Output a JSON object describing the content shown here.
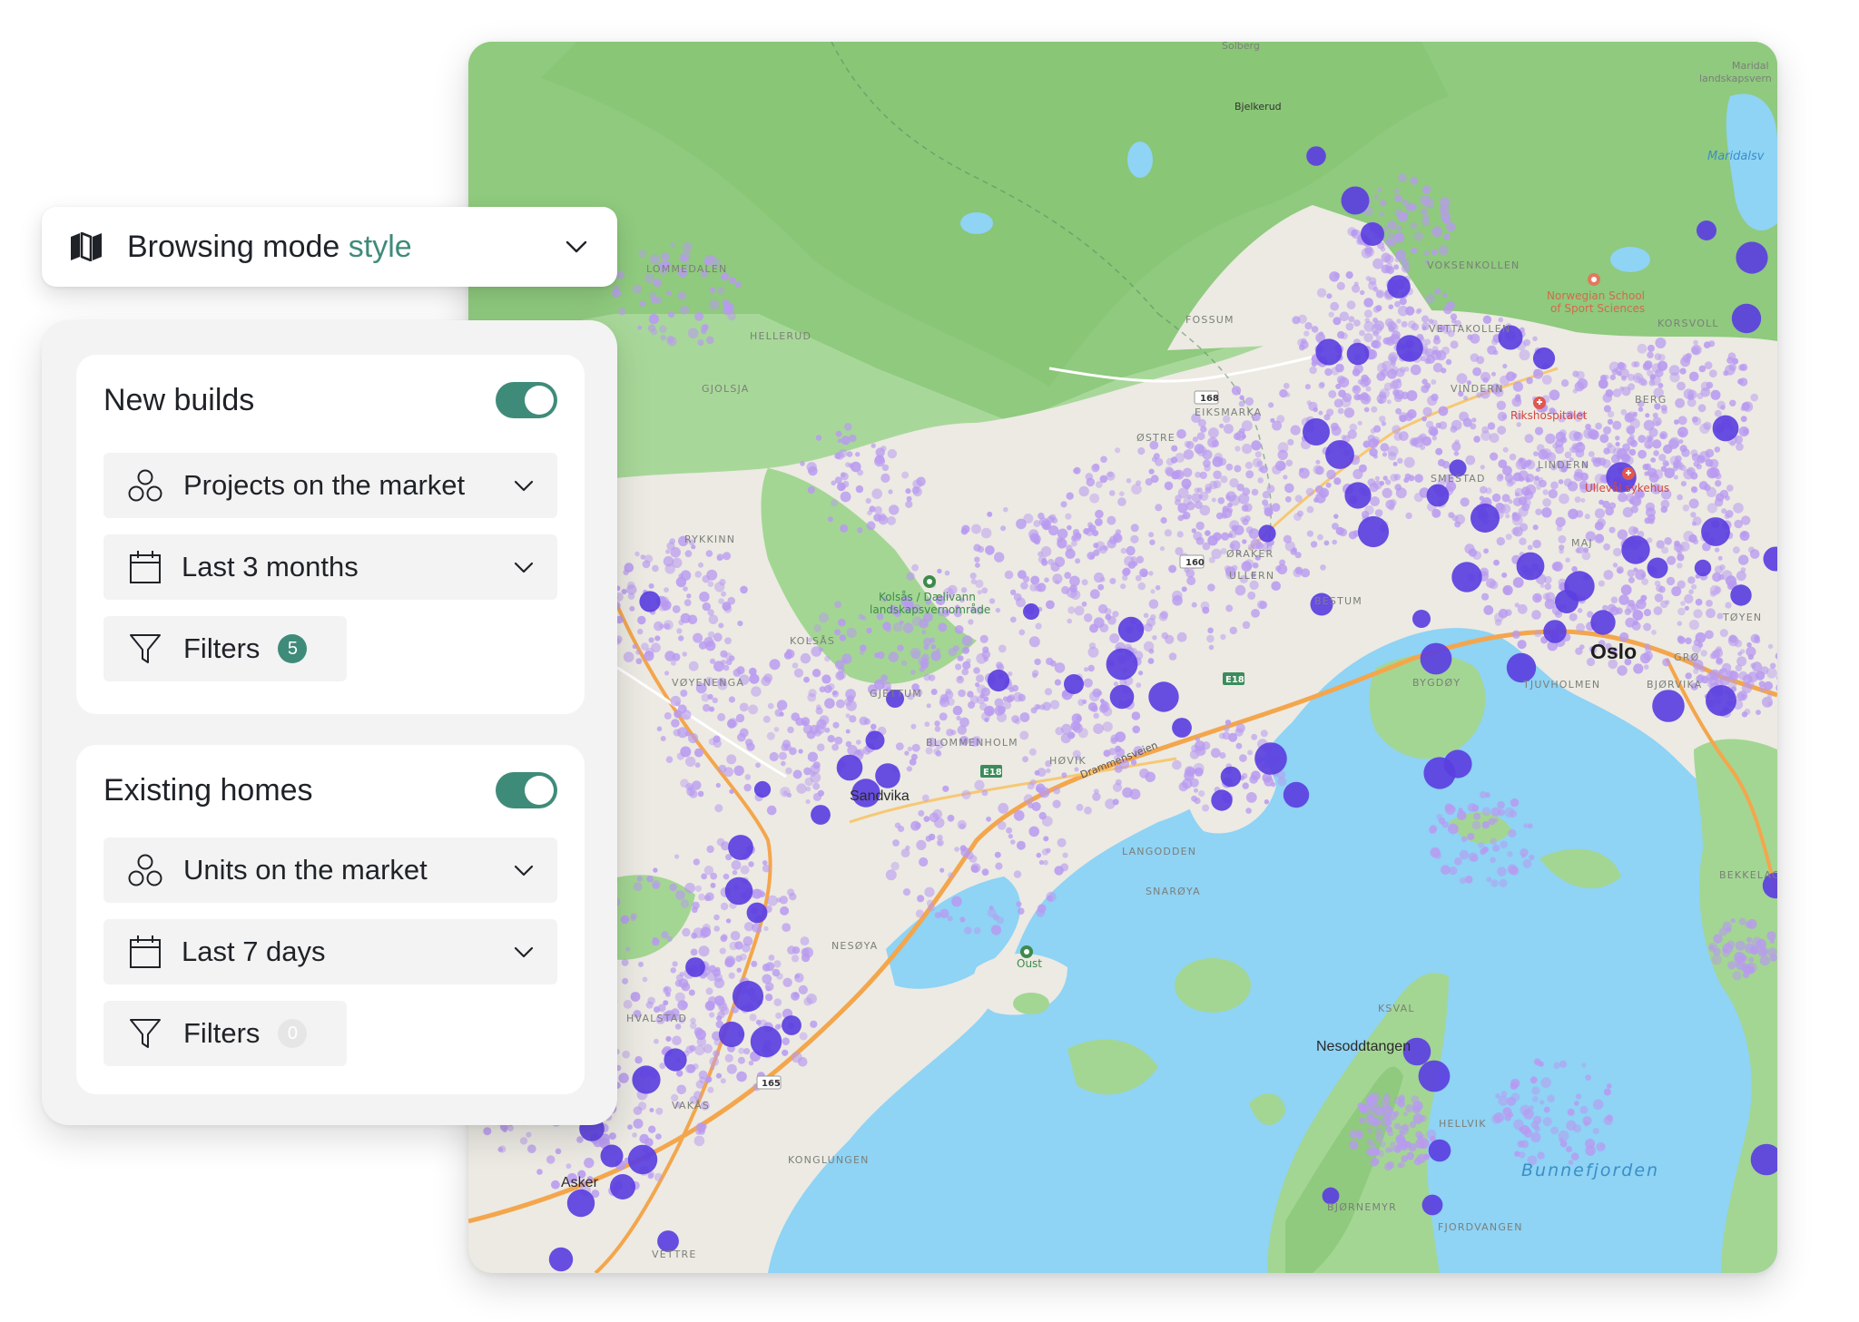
{
  "mode_select": {
    "label_main": "Browsing mode",
    "label_accent": "style",
    "icon": "map-icon"
  },
  "sections": [
    {
      "title": "New builds",
      "enabled": true,
      "type_label": "Projects on the market",
      "period_label": "Last 3 months",
      "filters_label": "Filters",
      "filters_count": "5"
    },
    {
      "title": "Existing homes",
      "enabled": true,
      "type_label": "Units on the market",
      "period_label": "Last 7 days",
      "filters_label": "Filters",
      "filters_count": "0"
    }
  ],
  "map": {
    "city": "Oslo",
    "town_1": "Sandvika",
    "town_2": "Nesoddtangen",
    "water_label": "Bunnefjorden",
    "park_label_1": "Kolsås / Dælivann",
    "park_label_2": "landskapsvernområde",
    "park_label_3": "Oust",
    "school_label_1": "Norwegian School",
    "school_label_2": "of Sport Sciences",
    "hospital_1": "Rikshospitalet",
    "hospital_2": "Ullevål sykehus",
    "road_drammensveien": "Drammensveien",
    "place_labels": {
      "solberg": "Solberg",
      "bjelkerud": "Bjelkerud",
      "maridal_1": "Maridal",
      "maridal_2": "landskapsvern",
      "maridalsvannet": "Maridalsv",
      "lommedalen": "LOMMEDALEN",
      "hellerud": "HELLERUD",
      "gjolsja": "GJOLSJA",
      "fossum": "FOSSUM",
      "vettakollen": "VETTAKOLLEN",
      "korsvoll": "KORSVOLL",
      "berg": "BERG",
      "lindern": "LINDERN",
      "ostre": "ØSTRE",
      "oraker": "ØRAKER",
      "ullern": "ULLERN",
      "bestum": "BESTUM",
      "bygdoy": "BYGDØY",
      "tjuvholmen": "TJUVHOLMEN",
      "bjorvika": "BJØRVIKA",
      "toyen": "TØYEN",
      "majorstuen": "MAJ",
      "gronland": "GRØ",
      "vovenenga": "VØYENENGA",
      "kolsas": "KOLSÅS",
      "rykkinn": "RYKKINN",
      "gjettum": "GJETTUM",
      "blommenholm": "BLOMMENHOLM",
      "hovik": "HØVIK",
      "langodden": "LANGODDEN",
      "snaroya": "SNARØYA",
      "nesoya": "NESØYA",
      "hvalstad": "HVALSTAD",
      "vakas": "VAKÅS",
      "kongsungen": "KONGLUNGEN",
      "vettre": "VETTRE",
      "hellvik": "HELLVIK",
      "fjordvangen": "FJORDVANGEN",
      "bekkelaget": "BEKKELAG",
      "asker": "Asker",
      "bjornemyr": "BJØRNEMYR",
      "voksen": "VOKSENKOLLEN",
      "smestad": "SMESTAD",
      "vinderen": "VINDERN",
      "eiksmarka": "EIKSMARKA",
      "kroken": "KSVAL"
    },
    "road_shields": [
      "168",
      "160",
      "E18",
      "E18",
      "165"
    ]
  },
  "colors": {
    "accent_green": "#3f8b7a",
    "marker_new": "#5b3fe0",
    "marker_existing": "#b89af0",
    "water": "#8fd3f5",
    "forest": "#96cf87",
    "urban": "#efeee9"
  }
}
